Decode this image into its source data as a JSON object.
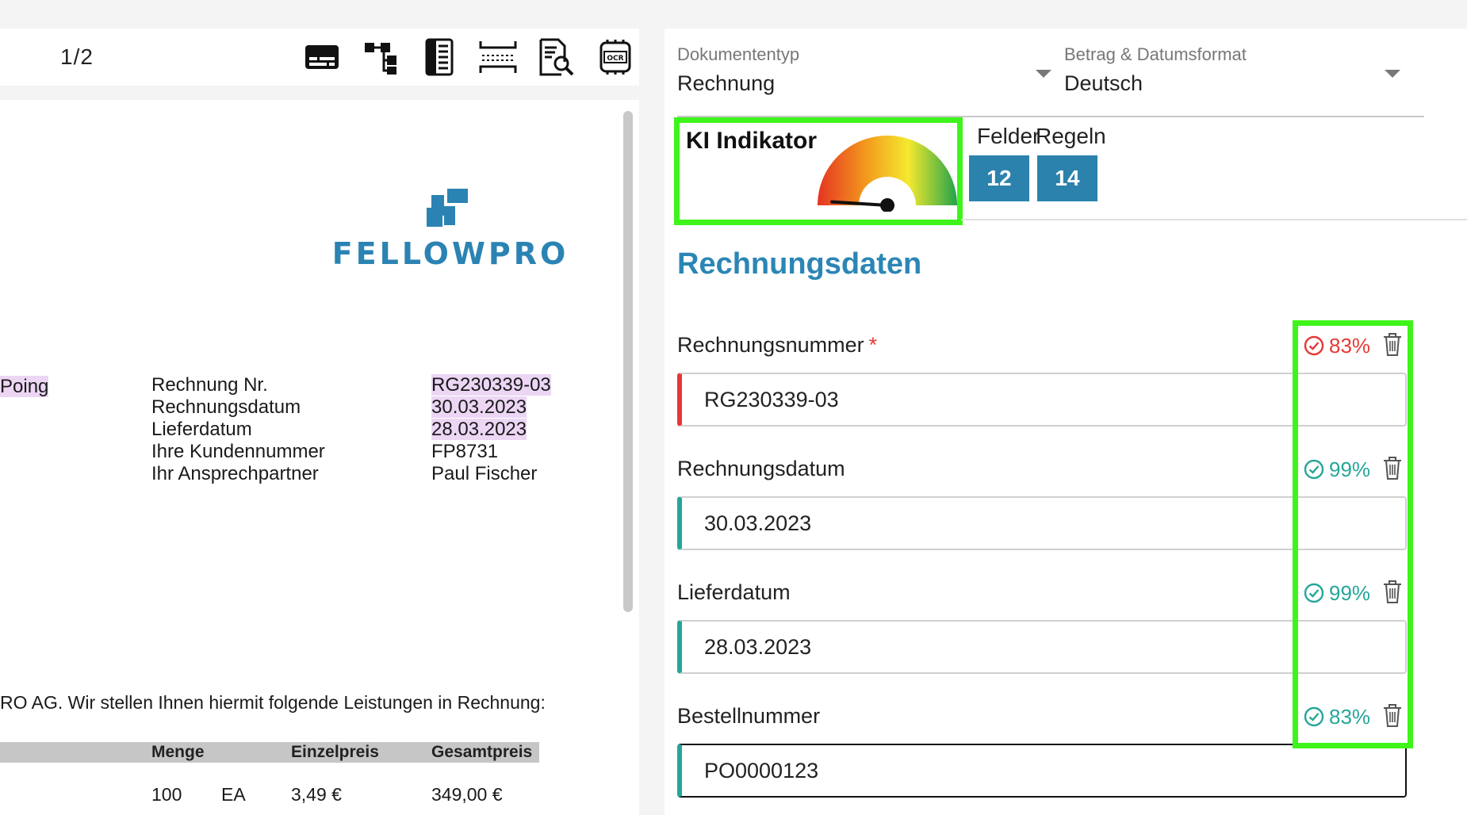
{
  "viewer": {
    "page_counter": "1/2",
    "tools": [
      "subtitles-icon",
      "tree-structure-icon",
      "document-lines-icon",
      "split-page-icon",
      "document-search-icon",
      "ocr-icon"
    ]
  },
  "document": {
    "logo_text": "FELLOWPRO",
    "address_fragment": "Poing",
    "labels": [
      "Rechnung Nr.",
      "Rechnungsdatum",
      "Lieferdatum",
      "Ihre Kundennummer",
      "Ihr Ansprechpartner"
    ],
    "values": [
      "RG230339-03",
      "30.03.2023",
      "28.03.2023",
      "FP8731",
      "Paul Fischer"
    ],
    "intro": "RO AG. Wir stellen Ihnen hiermit folgende Leistungen in Rechnung:",
    "table": {
      "headers": [
        "Menge",
        "Einzelpreis",
        "Gesamtpreis"
      ],
      "row": [
        "100",
        "EA",
        "3,49 €",
        "349,00 €"
      ]
    }
  },
  "panel": {
    "doc_type": {
      "label": "Dokumententyp",
      "value": "Rechnung"
    },
    "format": {
      "label": "Betrag & Datumsformat",
      "value": "Deutsch"
    },
    "ki_indicator": {
      "title": "KI Indikator",
      "level": 0.02
    },
    "counters": {
      "felder_label": "Felder",
      "felder_value": "12",
      "regeln_label": "Regeln",
      "regeln_value": "14"
    },
    "section_title": "Rechnungsdaten",
    "fields": [
      {
        "label": "Rechnungsnummer",
        "required": "*",
        "value": "RG230339-03",
        "confidence": "83%",
        "status": "error"
      },
      {
        "label": "Rechnungsdatum",
        "value": "30.03.2023",
        "confidence": "99%",
        "status": "ok"
      },
      {
        "label": "Lieferdatum",
        "value": "28.03.2023",
        "confidence": "99%",
        "status": "ok"
      },
      {
        "label": "Bestellnummer",
        "value": "PO0000123",
        "confidence": "83%",
        "status": "ok"
      }
    ],
    "colors": {
      "accent": "#2b86b5",
      "badge": "#2b82ad",
      "error": "#e53935",
      "ok": "#26a69a",
      "highlight_box": "#3ef41a"
    }
  }
}
